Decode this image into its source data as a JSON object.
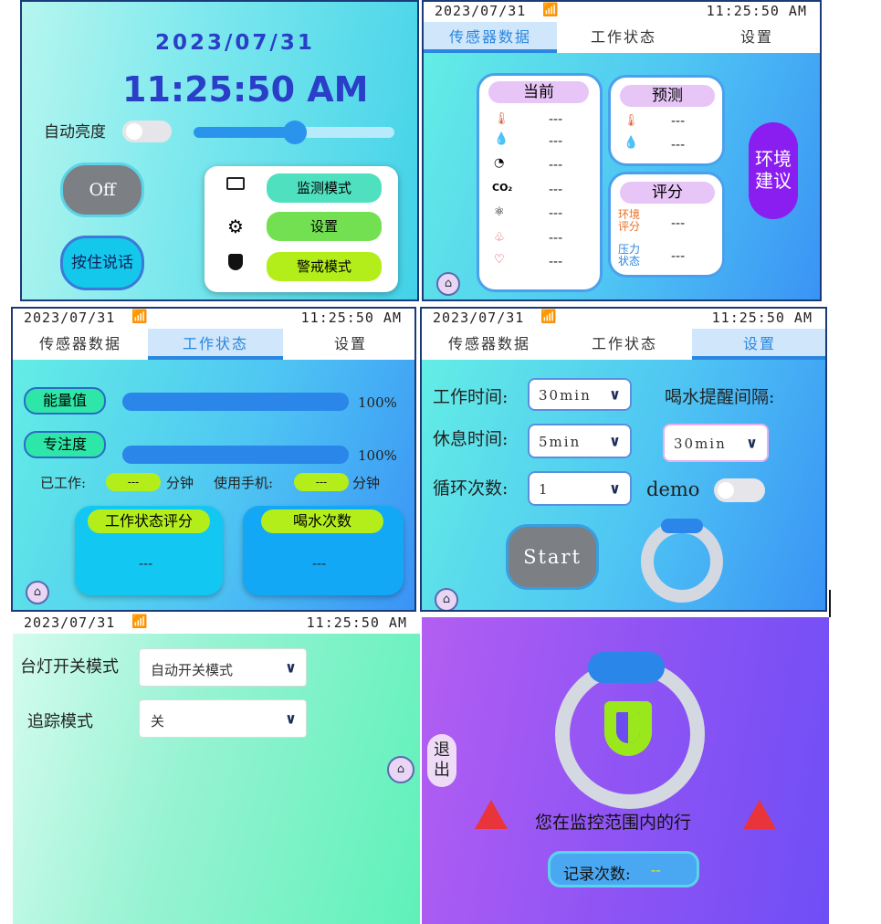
{
  "p1": {
    "date": "2023/07/31",
    "time": "11:25:50 AM",
    "auto_brightness_label": "自动亮度",
    "off_button": "Off",
    "hold_to_talk": "按住说话",
    "modes": [
      "监测模式",
      "设置",
      "警戒模式"
    ]
  },
  "status": {
    "date": "2023/07/31",
    "time": "11:25:50 AM"
  },
  "tabs": [
    "传感器数据",
    "工作状态",
    "设置"
  ],
  "p2": {
    "current_title": "当前",
    "current_values": [
      "---",
      "---",
      "---",
      "---",
      "---",
      "---",
      "---"
    ],
    "co2_label": "CO₂",
    "forecast_title": "预测",
    "forecast_values": [
      "---",
      "---"
    ],
    "score_title": "评分",
    "env_score_label": "环境评分",
    "env_score_value": "---",
    "stress_label": "压力状态",
    "stress_value": "---",
    "advice_button": "环境建议"
  },
  "p3": {
    "energy_label": "能量值",
    "energy_pct": "100%",
    "focus_label": "专注度",
    "focus_pct": "100%",
    "worked_label": "已工作:",
    "worked_value": "---",
    "minutes1": "分钟",
    "phone_label": "使用手机:",
    "phone_value": "---",
    "minutes2": "分钟",
    "work_score_title": "工作状态评分",
    "work_score_value": "---",
    "drink_title": "喝水次数",
    "drink_value": "---"
  },
  "p4": {
    "work_time_label": "工作时间:",
    "work_time_value": "30min",
    "rest_time_label": "休息时间:",
    "rest_time_value": "5min",
    "cycles_label": "循环次数:",
    "cycles_value": "1",
    "drink_interval_label": "喝水提醒间隔:",
    "drink_interval_value": "30min",
    "demo_label": "demo",
    "start_button": "Start"
  },
  "p5": {
    "lamp_mode_label": "台灯开关模式",
    "lamp_mode_value": "自动开关模式",
    "track_mode_label": "追踪模式",
    "track_mode_value": "关"
  },
  "p6": {
    "exit_button": "退出",
    "warning_text": "您在监控范围内的行",
    "record_label": "记录次数:",
    "record_value": "--"
  },
  "colors": {
    "accent": "#2a86e0",
    "purple": "#8a1df0",
    "green": "#9de830",
    "warning": "#e8343a"
  }
}
